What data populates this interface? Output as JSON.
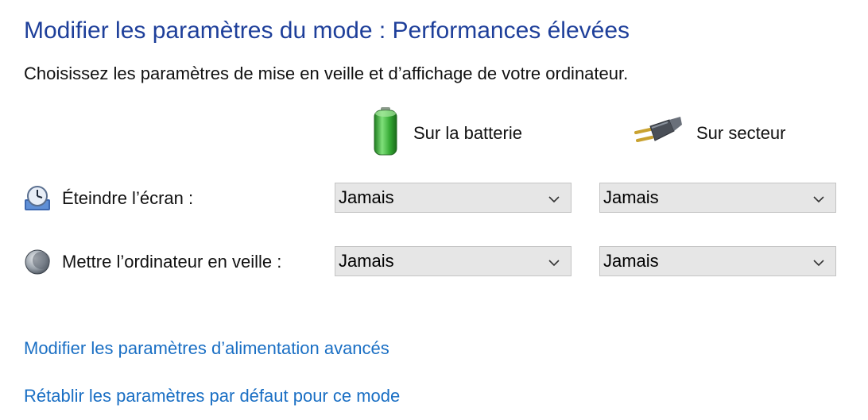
{
  "header": {
    "title": "Modifier les paramètres du mode : Performances élevées",
    "subtitle": "Choisissez les paramètres de mise en veille et d’affichage de votre ordinateur."
  },
  "columns": {
    "battery": {
      "label": "Sur la batterie",
      "icon": "battery-icon"
    },
    "plugged": {
      "label": "Sur secteur",
      "icon": "power-plug-icon"
    }
  },
  "rows": [
    {
      "label": "Éteindre l’écran :",
      "icon": "display-clock-icon",
      "battery_value": "Jamais",
      "plugged_value": "Jamais"
    },
    {
      "label": "Mettre l’ordinateur en veille :",
      "icon": "sleep-moon-icon",
      "battery_value": "Jamais",
      "plugged_value": "Jamais"
    }
  ],
  "links": {
    "advanced": "Modifier les paramètres d’alimentation avancés",
    "restore": "Rétablir les paramètres par défaut pour ce mode"
  },
  "colors": {
    "title": "#1e3f9a",
    "link": "#1a6fc4",
    "battery_green": "#3ca43a"
  }
}
